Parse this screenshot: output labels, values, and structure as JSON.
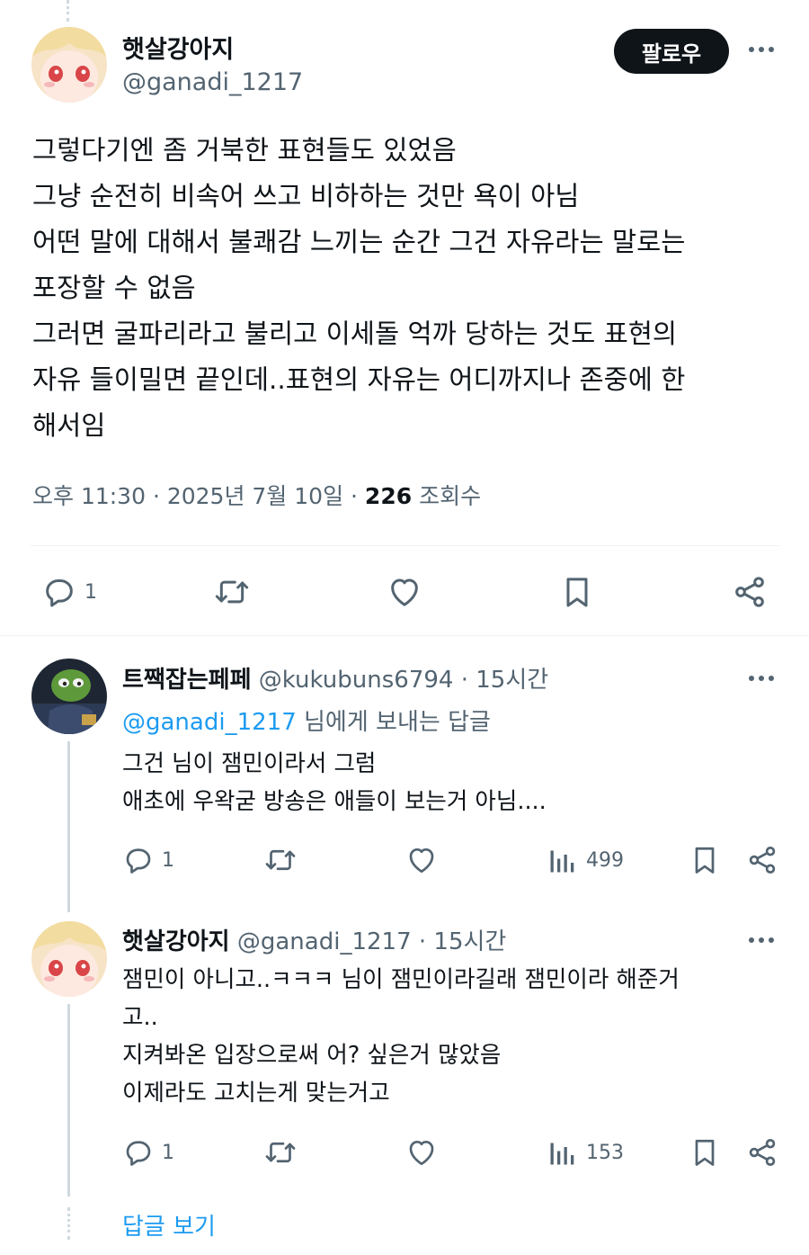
{
  "main_tweet": {
    "display_name": "햇살강아지",
    "handle": "@ganadi_1217",
    "follow_label": "팔로우",
    "body_lines": [
      "그렇다기엔 좀 거북한 표현들도 있었음",
      "그냥 순전히 비속어 쓰고 비하하는 것만 욕이 아님",
      "어떤 말에 대해서 불쾌감 느끼는 순간 그건 자유라는 말로는",
      "포장할 수 없음",
      "그러면 굴파리라고 불리고 이세돌 억까 당하는 것도 표현의",
      "자유 들이밀면 끝인데..표현의 자유는 어디까지나 존중에 한",
      "해서임"
    ],
    "time": "오후 11:30 · 2025년 7월 10일 ·",
    "views_count": "226",
    "views_label": "조회수",
    "reply_count": "1"
  },
  "reply1": {
    "display_name": "트짹잡는페페",
    "handle": "@kukubuns6794",
    "time": "· 15시간",
    "replying_to_handle": "@ganadi_1217",
    "replying_to_suffix": "님에게 보내는 답글",
    "body_lines": [
      "그건 님이 잼민이라서 그럼",
      "애초에 우왁굳 방송은 애들이 보는거 아님...."
    ],
    "reply_count": "1",
    "views": "499"
  },
  "reply2": {
    "display_name": "햇살강아지",
    "handle": "@ganadi_1217",
    "time": "· 15시간",
    "body_lines": [
      "잼민이 아니고..ㅋㅋㅋ 님이 잼민이라길래 잼민이라 해준거",
      "고..",
      "지켜봐온 입장으로써 어? 싶은거 많았음",
      "이제라도 고치는게 맞는거고"
    ],
    "reply_count": "1",
    "views": "153"
  },
  "show_replies_label": "답글 보기",
  "icons": {
    "reply": "reply-icon",
    "retweet": "retweet-icon",
    "like": "heart-icon",
    "bookmark": "bookmark-icon",
    "share": "share-icon",
    "views": "views-icon",
    "more": "more-icon"
  },
  "colors": {
    "text": "#0f1419",
    "secondary": "#536471",
    "link": "#1d9bf0",
    "divider": "#eff3f4"
  }
}
